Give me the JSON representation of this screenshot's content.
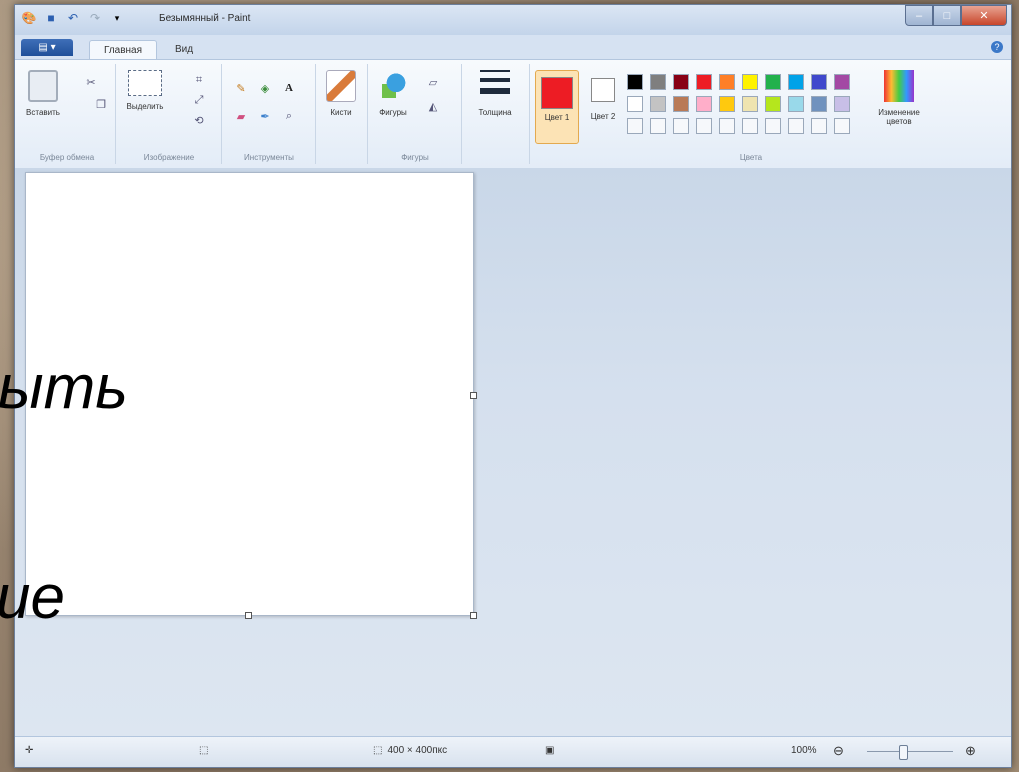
{
  "window": {
    "title": "Безымянный - Paint"
  },
  "tabs": {
    "file": "▤ ▾",
    "home": "Главная",
    "view": "Вид"
  },
  "ribbon": {
    "clipboard": {
      "paste": "Вставить",
      "label": "Буфер обмена"
    },
    "image": {
      "select": "Выделить",
      "label": "Изображение"
    },
    "tools": {
      "label": "Инструменты"
    },
    "brushes": {
      "label": "Кисти"
    },
    "shapes": {
      "shapes": "Фигуры",
      "label": "Фигуры"
    },
    "size": {
      "label": "Толщина"
    },
    "colors": {
      "color1": "Цвет 1",
      "color2": "Цвет 2",
      "edit": "Изменение цветов",
      "label": "Цвета",
      "row1": [
        "#000000",
        "#7f7f7f",
        "#880015",
        "#ed1c24",
        "#ff7f27",
        "#fff200",
        "#22b14c",
        "#00a2e8",
        "#3f48cc",
        "#a349a4"
      ],
      "row2": [
        "#ffffff",
        "#c3c3c3",
        "#b97a57",
        "#ffaec9",
        "#ffc90e",
        "#efe4b0",
        "#b5e61d",
        "#99d9ea",
        "#7092be",
        "#c8bfe7"
      ],
      "color1_value": "#ed1c24",
      "color2_value": "#ffffff"
    }
  },
  "status": {
    "size": "400 × 400пкс",
    "zoom": "100%"
  },
  "overlay": {
    "line1": "ыть",
    "line2": "ие"
  }
}
